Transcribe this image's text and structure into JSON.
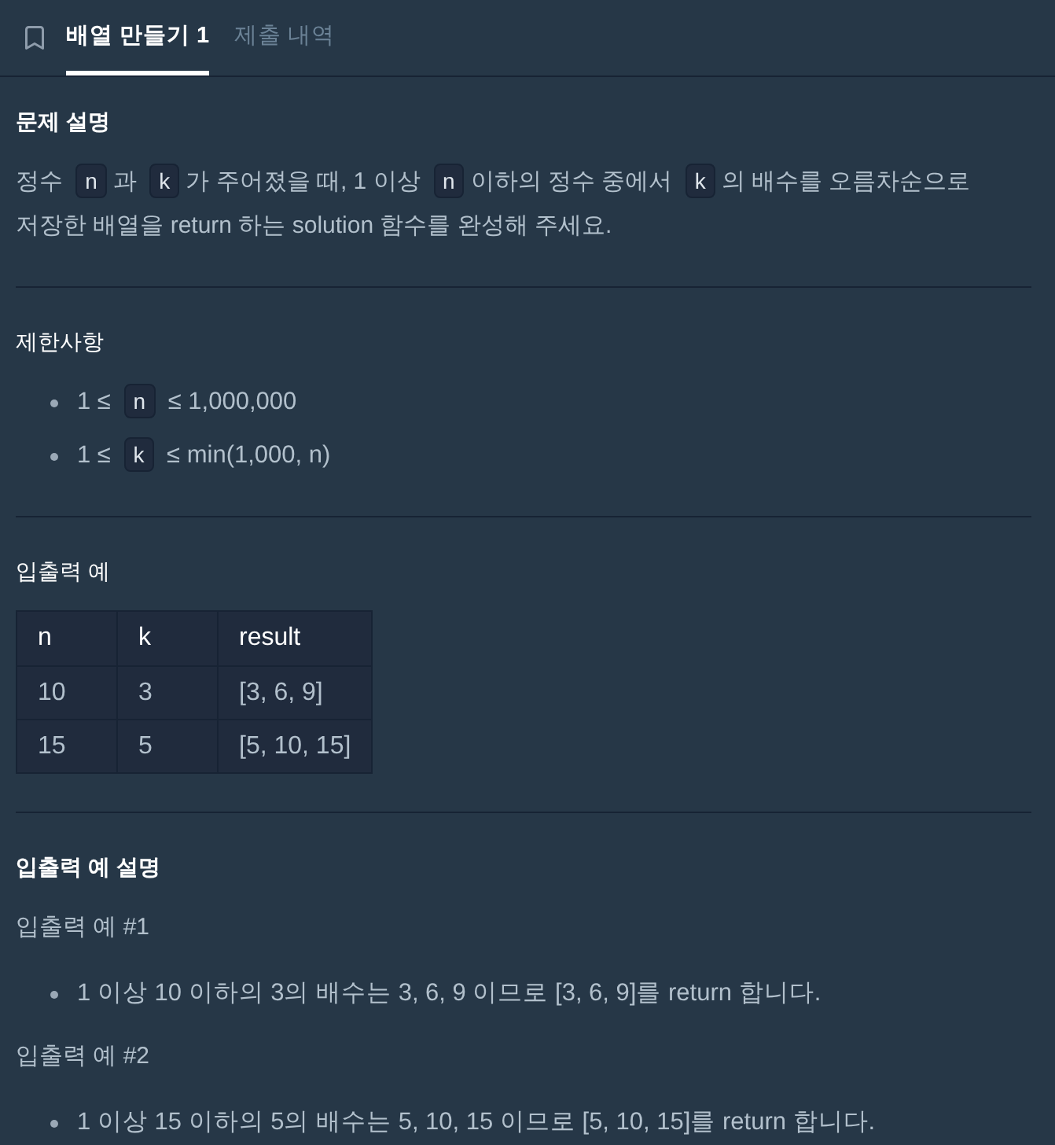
{
  "tabs": [
    {
      "label": "배열 만들기 1",
      "selected": true
    },
    {
      "label": "제출 내역",
      "selected": false
    }
  ],
  "sections": [
    {
      "heading": "문제 설명",
      "bold": true,
      "blocks": [
        {
          "kind": "paragraph",
          "segments": [
            {
              "kind": "text",
              "text": "정수 "
            },
            {
              "kind": "code",
              "text": "n"
            },
            {
              "kind": "text",
              "text": "과 "
            },
            {
              "kind": "code",
              "text": "k"
            },
            {
              "kind": "text",
              "text": "가 주어졌을 때, 1 이상 "
            },
            {
              "kind": "code",
              "text": "n"
            },
            {
              "kind": "text",
              "text": "이하의 정수 중에서 "
            },
            {
              "kind": "code",
              "text": "k"
            },
            {
              "kind": "text",
              "text": "의 배수를 오름차순으로 저장한 배열을 return 하는 solution 함수를 완성해 주세요."
            }
          ]
        }
      ]
    },
    {
      "heading": "제한사항",
      "bold": false,
      "blocks": [
        {
          "kind": "bullets",
          "items": [
            {
              "segments": [
                {
                  "kind": "text",
                  "text": "1 ≤ "
                },
                {
                  "kind": "code",
                  "text": "n"
                },
                {
                  "kind": "text",
                  "text": " ≤ 1,000,000"
                }
              ]
            },
            {
              "segments": [
                {
                  "kind": "text",
                  "text": "1 ≤ "
                },
                {
                  "kind": "code",
                  "text": "k"
                },
                {
                  "kind": "text",
                  "text": " ≤ min(1,000, n)"
                }
              ]
            }
          ]
        }
      ]
    },
    {
      "heading": "입출력 예",
      "bold": false,
      "blocks": [
        {
          "kind": "table",
          "columns": [
            "n",
            "k",
            "result"
          ],
          "rows": [
            [
              "10",
              "3",
              "[3, 6, 9]"
            ],
            [
              "15",
              "5",
              "[5, 10, 15]"
            ]
          ]
        }
      ]
    },
    {
      "heading": "입출력 예 설명",
      "bold": true,
      "blocks": [
        {
          "kind": "paragraph",
          "segments": [
            {
              "kind": "text",
              "text": "입출력 예 #1"
            }
          ]
        },
        {
          "kind": "bullets",
          "items": [
            {
              "segments": [
                {
                  "kind": "text",
                  "text": "1 이상 10 이하의 3의 배수는 3, 6, 9 이므로 [3, 6, 9]를 return 합니다."
                }
              ]
            }
          ]
        },
        {
          "kind": "paragraph",
          "segments": [
            {
              "kind": "text",
              "text": "입출력 예 #2"
            }
          ]
        },
        {
          "kind": "bullets",
          "items": [
            {
              "segments": [
                {
                  "kind": "text",
                  "text": "1 이상 15 이하의 5의 배수는 5, 10, 15 이므로 [5, 10, 15]를 return 합니다."
                }
              ]
            }
          ]
        }
      ]
    }
  ]
}
